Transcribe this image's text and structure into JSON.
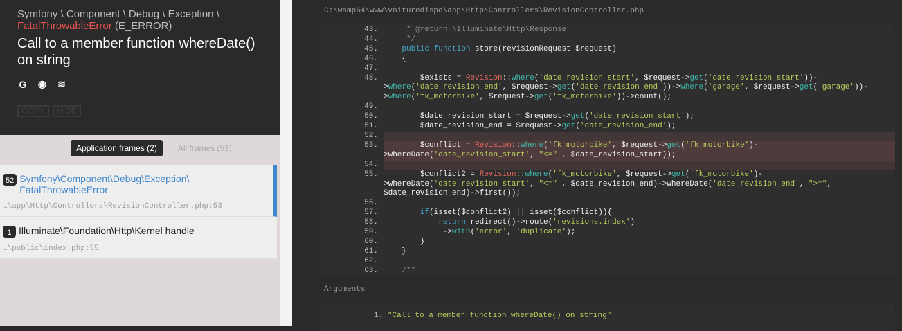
{
  "exception": {
    "namespace": "Symfony \\ Component \\ Debug \\ Exception \\",
    "class": "FatalThrowableError",
    "type": "(E_ERROR)",
    "message": "Call to a member function whereDate() on string"
  },
  "search_icons": [
    {
      "name": "google-icon",
      "glyph": "G"
    },
    {
      "name": "duckduckgo-icon",
      "glyph": "◉"
    },
    {
      "name": "stackoverflow-icon",
      "glyph": "≋"
    }
  ],
  "buttons": {
    "copy": "COPY",
    "hide": "HIDE"
  },
  "filters": {
    "application": "Application frames (2)",
    "all": "All frames (53)"
  },
  "frames": [
    {
      "num": "52",
      "class": "Symfony\\Component\\Debug\\Exception\\ FatalThrowableError",
      "file": "…\\app\\Http\\Controllers\\RevisionController.php:53"
    },
    {
      "num": "1",
      "class": "Illuminate\\Foundation\\Http\\Kernel handle",
      "file": "…\\public\\index.php:55"
    }
  ],
  "file_path": "C:\\wamp64\\www\\voituredispo\\app\\Http\\Controllers\\RevisionController.php",
  "code": [
    {
      "n": "43.",
      "t": [
        [
          "c",
          "     * @return \\Illuminate\\Http\\Response"
        ]
      ]
    },
    {
      "n": "44.",
      "t": [
        [
          "c",
          "     */"
        ]
      ]
    },
    {
      "n": "45.",
      "t": [
        [
          "p",
          "    "
        ],
        [
          "k",
          "public function"
        ],
        [
          "p",
          " store(revisionRequest $request)"
        ]
      ]
    },
    {
      "n": "46.",
      "t": [
        [
          "p",
          "    {"
        ]
      ]
    },
    {
      "n": "47.",
      "t": []
    },
    {
      "n": "48.",
      "t": [
        [
          "p",
          "        $exists = "
        ],
        [
          "cl",
          "Revision"
        ],
        [
          "p",
          "::"
        ],
        [
          "f",
          "where"
        ],
        [
          "p",
          "("
        ],
        [
          "s",
          "'date_revision_start'"
        ],
        [
          "p",
          ", $request->"
        ],
        [
          "f",
          "get"
        ],
        [
          "p",
          "("
        ],
        [
          "s",
          "'date_revision_start'"
        ],
        [
          "p",
          "))->"
        ],
        [
          "f",
          "where"
        ],
        [
          "p",
          "("
        ],
        [
          "s",
          "'date_revision_end'"
        ],
        [
          "p",
          ", $request->"
        ],
        [
          "f",
          "get"
        ],
        [
          "p",
          "("
        ],
        [
          "s",
          "'date_revision_end'"
        ],
        [
          "p",
          "))->"
        ],
        [
          "f",
          "where"
        ],
        [
          "p",
          "("
        ],
        [
          "s",
          "'garage'"
        ],
        [
          "p",
          ", $request->"
        ],
        [
          "f",
          "get"
        ],
        [
          "p",
          "("
        ],
        [
          "s",
          "'garage'"
        ],
        [
          "p",
          "))->"
        ],
        [
          "f",
          "where"
        ],
        [
          "p",
          "("
        ],
        [
          "s",
          "'fk_motorbike'"
        ],
        [
          "p",
          ", $request->"
        ],
        [
          "f",
          "get"
        ],
        [
          "p",
          "("
        ],
        [
          "s",
          "'fk_motorbike'"
        ],
        [
          "p",
          "))->count();"
        ]
      ]
    },
    {
      "n": "49.",
      "t": []
    },
    {
      "n": "50.",
      "t": [
        [
          "p",
          "        $date_revision_start = $request->"
        ],
        [
          "f",
          "get"
        ],
        [
          "p",
          "("
        ],
        [
          "s",
          "'date_revision_start'"
        ],
        [
          "p",
          ");"
        ]
      ]
    },
    {
      "n": "51.",
      "t": [
        [
          "p",
          "        $date_revision_end = $request->"
        ],
        [
          "f",
          "get"
        ],
        [
          "p",
          "("
        ],
        [
          "s",
          "'date_revision_end'"
        ],
        [
          "p",
          ");"
        ]
      ]
    },
    {
      "n": "52.",
      "t": [],
      "hl": 2
    },
    {
      "n": "53.",
      "t": [
        [
          "p",
          "        $conflict = "
        ],
        [
          "cl",
          "Revision"
        ],
        [
          "p",
          "::"
        ],
        [
          "f",
          "where"
        ],
        [
          "p",
          "("
        ],
        [
          "s",
          "'fk_motorbike'"
        ],
        [
          "p",
          ", $request->"
        ],
        [
          "f",
          "get"
        ],
        [
          "p",
          "("
        ],
        [
          "s",
          "'fk_motorbike'"
        ],
        [
          "p",
          ")->whereDate("
        ],
        [
          "s",
          "'date_revision_start'"
        ],
        [
          "p",
          ", "
        ],
        [
          "s",
          "\"<=\""
        ],
        [
          "p",
          " , $date_revision_start));"
        ]
      ],
      "hl": 1
    },
    {
      "n": "54.",
      "t": [],
      "hl": 2
    },
    {
      "n": "55.",
      "t": [
        [
          "p",
          "        $conflict2 = "
        ],
        [
          "cl",
          "Revision"
        ],
        [
          "p",
          "::"
        ],
        [
          "f",
          "where"
        ],
        [
          "p",
          "("
        ],
        [
          "s",
          "'fk_motorbike'"
        ],
        [
          "p",
          ", $request->"
        ],
        [
          "f",
          "get"
        ],
        [
          "p",
          "("
        ],
        [
          "s",
          "'fk_motorbike'"
        ],
        [
          "p",
          ")->whereDate("
        ],
        [
          "s",
          "'date_revision_start'"
        ],
        [
          "p",
          ", "
        ],
        [
          "s",
          "\"<=\""
        ],
        [
          "p",
          " , $date_revision_end)->whereDate("
        ],
        [
          "s",
          "'date_revision_end'"
        ],
        [
          "p",
          ", "
        ],
        [
          "s",
          "\">=\""
        ],
        [
          "p",
          ", $date_revision_end)->first());"
        ]
      ]
    },
    {
      "n": "56.",
      "t": []
    },
    {
      "n": "57.",
      "t": [
        [
          "p",
          "        "
        ],
        [
          "k",
          "if"
        ],
        [
          "p",
          "(isset($conflict2) || isset($conflict)){"
        ]
      ]
    },
    {
      "n": "58.",
      "t": [
        [
          "p",
          "            "
        ],
        [
          "k",
          "return"
        ],
        [
          "p",
          " redirect()->route("
        ],
        [
          "s",
          "'revisions.index'"
        ],
        [
          "p",
          ")"
        ]
      ]
    },
    {
      "n": "59.",
      "t": [
        [
          "p",
          "             ->"
        ],
        [
          "f",
          "with"
        ],
        [
          "p",
          "("
        ],
        [
          "s",
          "'error'"
        ],
        [
          "p",
          ", "
        ],
        [
          "s",
          "'duplicate'"
        ],
        [
          "p",
          ");"
        ]
      ]
    },
    {
      "n": "60.",
      "t": [
        [
          "p",
          "        }"
        ]
      ]
    },
    {
      "n": "61.",
      "t": [
        [
          "p",
          "    }"
        ]
      ]
    },
    {
      "n": "62.",
      "t": []
    },
    {
      "n": "63.",
      "t": [
        [
          "p",
          "    "
        ],
        [
          "c",
          "/**"
        ]
      ]
    }
  ],
  "arguments": {
    "label": "Arguments",
    "items": [
      {
        "n": "1.",
        "value": "\"Call to a member function whereDate() on string\""
      }
    ]
  }
}
